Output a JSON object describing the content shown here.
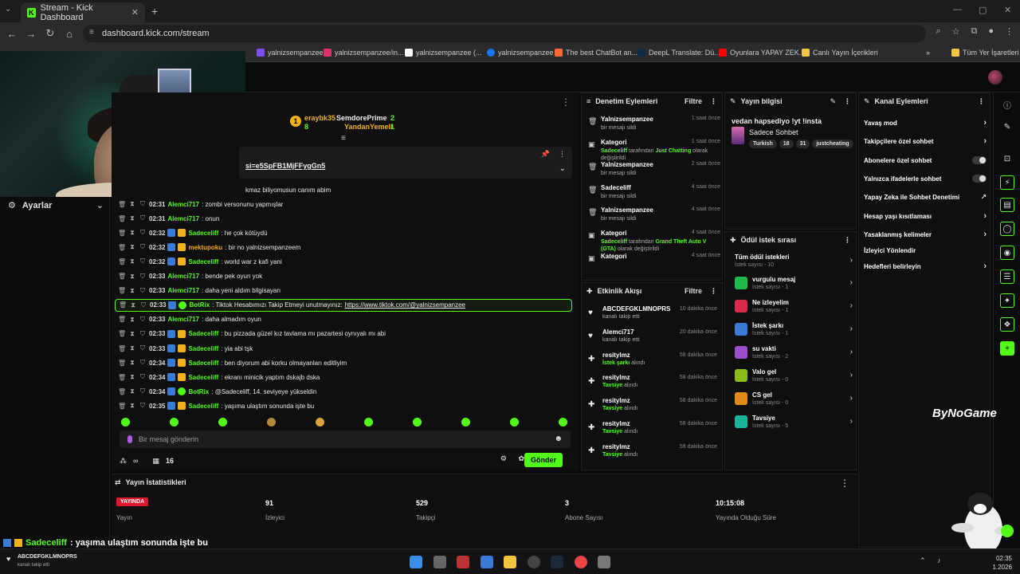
{
  "browser": {
    "tab_title": "Stream - Kick Dashboard",
    "url": "dashboard.kick.com/stream",
    "bookmarks": [
      {
        "label": "yalnizsempanzee",
        "color": "#7c4dff"
      },
      {
        "label": "yalnizsempanzee/in...",
        "color": "#e1306c"
      },
      {
        "label": "yalnizsempanzee (...",
        "color": "#ffffff"
      },
      {
        "label": "yalnizsempanzee",
        "color": "#1877f2"
      },
      {
        "label": "The best ChatBot an...",
        "color": "#ff6b35"
      },
      {
        "label": "DeepL Translate: Dü...",
        "color": "#0f2b46"
      },
      {
        "label": "Oyunlara YAPAY ZEK...",
        "color": "#ff0000"
      },
      {
        "label": "Canlı Yayın İçerikleri",
        "color": "#f5c542"
      }
    ],
    "all_bookmarks": "Tüm Yer İşaretleri"
  },
  "sidebar": {
    "settings_label": "Ayarlar"
  },
  "chat": {
    "gifters": {
      "rank": "1",
      "first": {
        "name": "eraybk35",
        "count": "8"
      },
      "second": {
        "name": "SemdorePrime",
        "count": "2"
      },
      "third": {
        "name": "YandanYemeli",
        "count": "1"
      }
    },
    "pinned_text": "si=e5SpFB1MjFFygGn5",
    "partial_line": "kmaz biliyomusun canım abim",
    "lines": [
      {
        "time": "02:31",
        "user": "Alemci717",
        "color": "#53fc18",
        "msg": ": zombi versonunu yapmışlar"
      },
      {
        "time": "02:31",
        "user": "Alemci717",
        "color": "#53fc18",
        "msg": ": onun"
      },
      {
        "time": "02:32",
        "user": "Sadeceliff",
        "color": "#53fc18",
        "msg": ": he çok kötüydü"
      },
      {
        "time": "02:32",
        "user": "mektupoku",
        "color": "#f5a623",
        "msg": ": bir no yalnizsempanzeem"
      },
      {
        "time": "02:32",
        "user": "Sadeceliff",
        "color": "#53fc18",
        "msg": ": world war z kafi yani"
      },
      {
        "time": "02:33",
        "user": "Alemci717",
        "color": "#53fc18",
        "msg": ": bende pek oyun yok"
      },
      {
        "time": "02:33",
        "user": "Alemci717",
        "color": "#53fc18",
        "msg": ": daha yeni aldım bilgisayarı"
      },
      {
        "time": "02:33",
        "user": "BotRix",
        "color": "#53fc18",
        "msg": ": Tiktok Hesabımızı Takip Etmeyi unutmayınız:",
        "link": "https://www.tiktok.com/@yalnizsempanzee"
      },
      {
        "time": "02:33",
        "user": "Alemci717",
        "color": "#53fc18",
        "msg": ": daha almadım oyun"
      },
      {
        "time": "02:33",
        "user": "Sadeceliff",
        "color": "#53fc18",
        "msg": ": bu pizzada güzel kız tavlama mı pazartesi oynıyalı mı abi"
      },
      {
        "time": "02:33",
        "user": "Sadeceliff",
        "color": "#53fc18",
        "msg": ": yia abi tşk"
      },
      {
        "time": "02:34",
        "user": "Sadeceliff",
        "color": "#53fc18",
        "msg": ": ben diyorum abi korku olmayanları editliyim"
      },
      {
        "time": "02:34",
        "user": "Sadeceliff",
        "color": "#53fc18",
        "msg": ": ekranı minicik yaptım dskajb dska"
      },
      {
        "time": "02:34",
        "user": "BotRix",
        "color": "#53fc18",
        "msg": ": @Sadeceliff, 14. seviyeye yükseldin"
      },
      {
        "time": "02:35",
        "user": "Sadeceliff",
        "color": "#53fc18",
        "msg": ": yaşıma ulaştım sonunda işte bu"
      }
    ],
    "input_placeholder": "Bir mesaj gönderin",
    "viewer_count_label": "∞",
    "slow_count": "16",
    "send_label": "Gönder"
  },
  "mod_actions": {
    "title": "Denetim Eylemleri",
    "filter": "Filtre",
    "items": [
      {
        "title": "Yalnizsempanzee",
        "ago": "1 saat önce",
        "desc": "bir mesajı sildi",
        "icon": "trash"
      },
      {
        "title": "Kategori",
        "ago": "1 saat önce",
        "desc_user": "Sadeceliff",
        "desc_mid": " tarafından ",
        "desc_hl": "Just Chatting",
        "desc_end": " olarak değiştirildi",
        "icon": "category"
      },
      {
        "title": "Yalnizsempanzee",
        "ago": "2 saat önce",
        "desc": "bir mesajı sildi",
        "icon": "trash"
      },
      {
        "title": "Sadeceliff",
        "ago": "4 saat önce",
        "desc": "bir mesajı sildi",
        "icon": "trash"
      },
      {
        "title": "Yalnizsempanzee",
        "ago": "4 saat önce",
        "desc": "bir mesajı sildi",
        "icon": "trash"
      },
      {
        "title": "Kategori",
        "ago": "4 saat önce",
        "desc_user": "Sadeceliff",
        "desc_mid": " tarafından ",
        "desc_hl": "Grand Theft Auto V (GTA)",
        "desc_end": " olarak değiştirildi",
        "icon": "category"
      },
      {
        "title": "Kategori",
        "ago": "4 saat önce",
        "desc": "",
        "icon": "category"
      }
    ]
  },
  "activity": {
    "title": "Etkinlik Akışı",
    "filter": "Filtre",
    "items": [
      {
        "name": "ABCDEFGKLMNOPRS",
        "ago": "10 dakika önce",
        "sub": "kanalı takip etti",
        "kind": "follow"
      },
      {
        "name": "Alemci717",
        "ago": "20 dakika önce",
        "sub": "kanalı takip etti",
        "kind": "follow"
      },
      {
        "name": "resitylmz",
        "ago": "58 dakika önce",
        "sub_hl": "İstek şarkı",
        "sub": " alındı",
        "kind": "reward"
      },
      {
        "name": "resitylmz",
        "ago": "58 dakika önce",
        "sub_hl": "Tavsiye",
        "sub": " alındı",
        "kind": "reward"
      },
      {
        "name": "resitylmz",
        "ago": "58 dakika önce",
        "sub_hl": "Tavsiye",
        "sub": " alındı",
        "kind": "reward"
      },
      {
        "name": "resitylmz",
        "ago": "58 dakika önce",
        "sub_hl": "Tavsiye",
        "sub": " alındı",
        "kind": "reward"
      },
      {
        "name": "resitylmz",
        "ago": "58 dakika önce",
        "sub_hl": "Tavsiye",
        "sub": " alındı",
        "kind": "reward"
      }
    ]
  },
  "stream_info": {
    "title": "Yayın bilgisi",
    "stream_title": "vedan hapsediyo !yt !insta",
    "category": "Sadece Sohbet",
    "tags": [
      "Turkish",
      "18",
      "31",
      "justcheating"
    ]
  },
  "rewards": {
    "title": "Ödül istek sırası",
    "all_label": "Tüm ödül istekleri",
    "all_sub": "İstek sayısı - 10",
    "items": [
      {
        "name": "vurgulu mesaj",
        "sub": "İstek sayısı - 1",
        "color": "#1fb84a"
      },
      {
        "name": "Ne izleyelim",
        "sub": "İstek sayısı - 1",
        "color": "#d92b4b"
      },
      {
        "name": "İstek şarkı",
        "sub": "İstek sayısı - 1",
        "color": "#3a7bd5"
      },
      {
        "name": "su vakti",
        "sub": "İstek sayısı - 2",
        "color": "#9b4dca"
      },
      {
        "name": "Valo gel",
        "sub": "İstek sayısı - 0",
        "color": "#8ab91a"
      },
      {
        "name": "CS gel",
        "sub": "İstek sayısı - 0",
        "color": "#e08a1a"
      },
      {
        "name": "Tavsiye",
        "sub": "İstek sayısı - 5",
        "color": "#19b39a"
      }
    ]
  },
  "channel_actions": {
    "title": "Kanal Eylemleri",
    "items": [
      {
        "label": "Yavaş mod",
        "kind": "chev"
      },
      {
        "label": "Takipçilere özel sohbet",
        "kind": "chev"
      },
      {
        "label": "Abonelere özel sohbet",
        "kind": "toggle"
      },
      {
        "label": "Yalnızca ifadelerle sohbet",
        "kind": "toggle"
      },
      {
        "label": "Yapay Zeka ile Sohbet Denetimi",
        "kind": "ext"
      },
      {
        "label": "Hesap yaşı kısıtlaması",
        "kind": "chev"
      },
      {
        "label": "Yasaklanmış kelimeler",
        "kind": "chev"
      },
      {
        "label": "İzleyici Yönlendir",
        "kind": "none"
      },
      {
        "label": "Hedefleri belirleyin",
        "kind": "chev"
      }
    ]
  },
  "stats": {
    "title": "Yayın İstatistikleri",
    "live_badge": "YAYINDA",
    "items": [
      {
        "value": "",
        "label": "Yayın"
      },
      {
        "value": "91",
        "label": "İzleyici"
      },
      {
        "value": "529",
        "label": "Takipçi"
      },
      {
        "value": "3",
        "label": "Abone Sayısı"
      },
      {
        "value": "10:15:08",
        "label": "Yayında Olduğu Süre"
      }
    ]
  },
  "overlay": {
    "user": "Sadeceliff",
    "msg": ": yaşıma ulaştım sonunda işte bu",
    "logo": "ByNoGame"
  },
  "taskbar": {
    "alert_name": "ABCDEFGKLMNOPRS",
    "alert_sub": "kanalı takip etti",
    "clock_time": "02:35",
    "clock_date": "1.2026"
  }
}
